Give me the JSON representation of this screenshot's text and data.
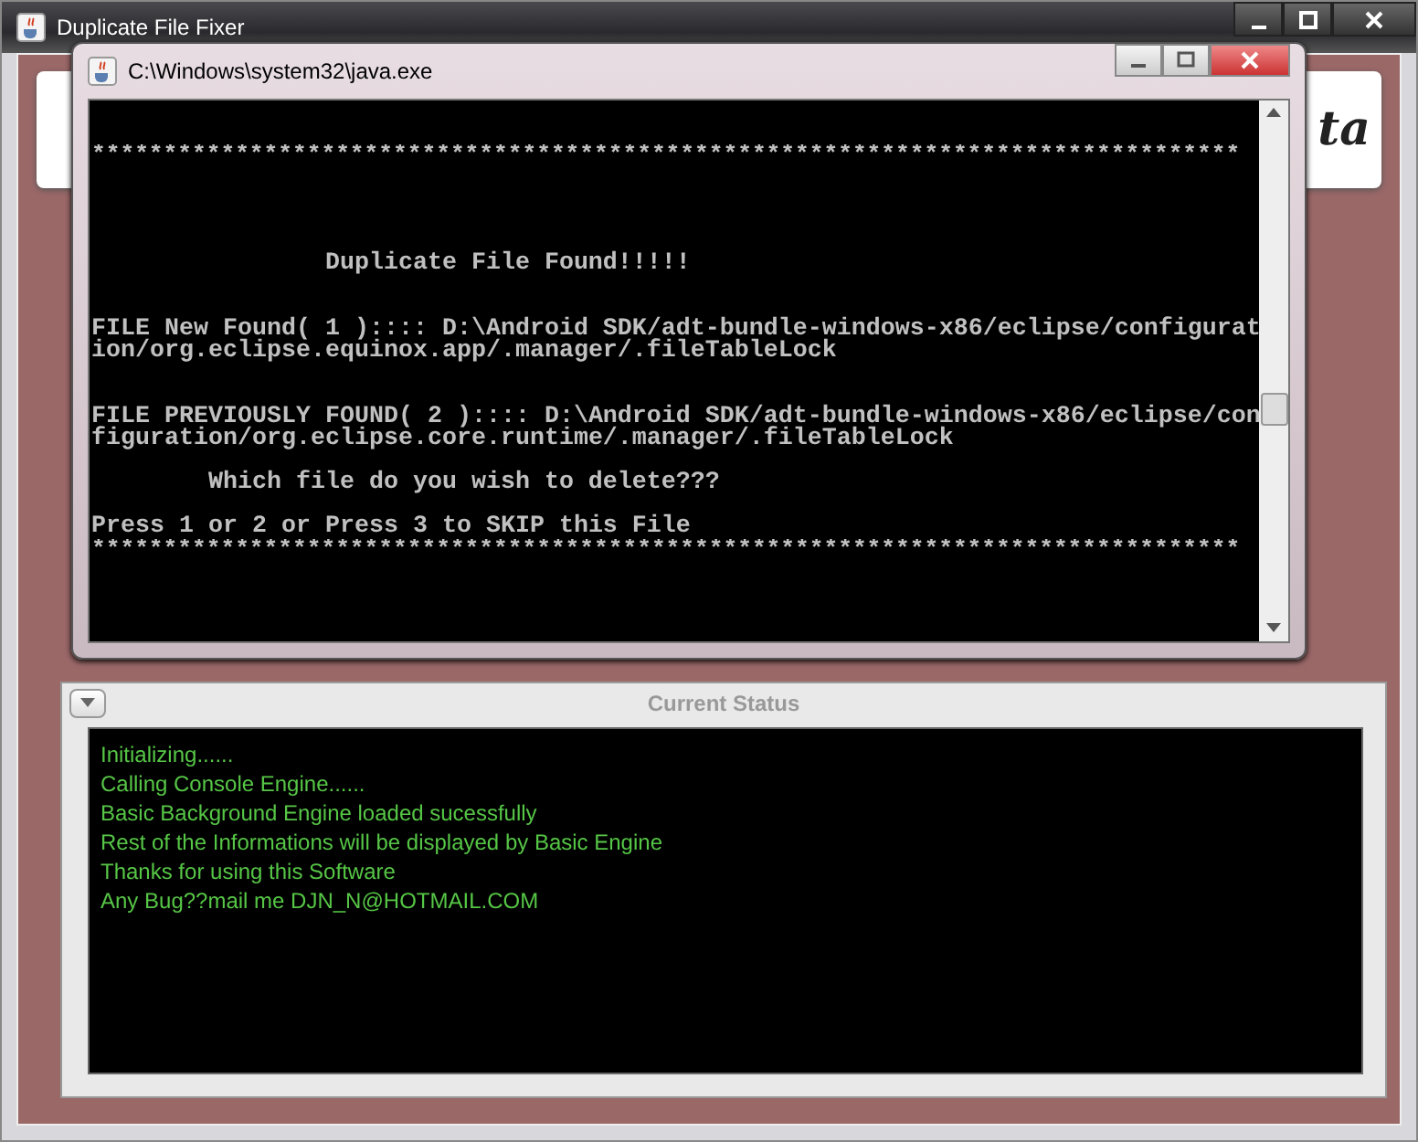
{
  "main_window": {
    "title": "Duplicate File Fixer",
    "banner_text": "ta"
  },
  "console_window": {
    "title": "C:\\Windows\\system32\\java.exe",
    "lines": [
      {
        "kind": "separator",
        "text": "********************************************************************************"
      },
      {
        "kind": "heading",
        "text": "Duplicate File Found!!!!!"
      },
      {
        "kind": "text",
        "text": "FILE New Found( 1 ):::: D:\\Android SDK/adt-bundle-windows-x86/eclipse/configuration/org.eclipse.equinox.app/.manager/.fileTableLock"
      },
      {
        "kind": "text",
        "text": "FILE PREVIOUSLY FOUND( 2 ):::: D:\\Android SDK/adt-bundle-windows-x86/eclipse/configuration/org.eclipse.core.runtime/.manager/.fileTableLock"
      },
      {
        "kind": "question",
        "text": "Which file do you wish to delete???"
      },
      {
        "kind": "text",
        "text": "Press 1 or 2 or Press 3 to SKIP this File"
      },
      {
        "kind": "separator",
        "text": "********************************************************************************"
      }
    ]
  },
  "status_panel": {
    "title": "Current Status",
    "expanded": true,
    "lines": [
      "Initializing......",
      "Calling Console Engine......",
      "Basic Background Engine loaded sucessfully",
      "Rest of the Informations will be displayed by Basic Engine",
      "Thanks for using this Software",
      "Any Bug??mail me DJN_N@HOTMAIL.COM"
    ]
  }
}
